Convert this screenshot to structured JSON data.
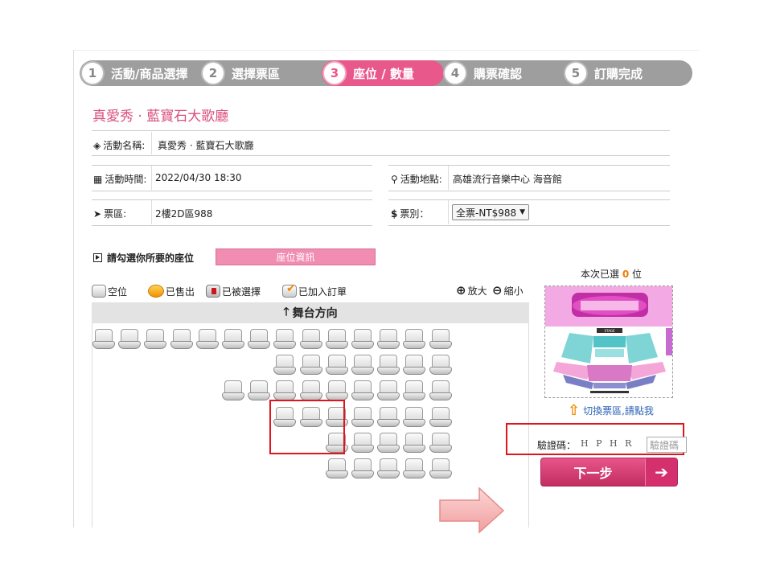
{
  "steps": [
    {
      "num": "1",
      "label": "活動/商品選擇"
    },
    {
      "num": "2",
      "label": "選擇票區"
    },
    {
      "num": "3",
      "label": "座位 / 數量"
    },
    {
      "num": "4",
      "label": "購票確認"
    },
    {
      "num": "5",
      "label": "訂購完成"
    }
  ],
  "event_title": "真愛秀 · 藍寶石大歌廳",
  "info": {
    "name_label": "活動名稱:",
    "name_value": "真愛秀 · 藍寶石大歌廳",
    "time_label": "活動時間:",
    "time_value": "2022/04/30 18:30",
    "place_label": "活動地點:",
    "place_value": "高雄流行音樂中心 海音館",
    "area_label": "票區:",
    "area_value": "2樓2D區988",
    "type_label": "票別：",
    "type_value": "全票-NT$988"
  },
  "choose_label": "請勾選你所要的座位",
  "seat_info_button": "座位資訊",
  "legend": {
    "empty": "空位",
    "sold": "已售出",
    "taken": "已被選擇",
    "ordered": "已加入訂單"
  },
  "zoom": {
    "in": "放大",
    "out": "縮小"
  },
  "stage_label": "舞台方向",
  "seat_rows": [
    {
      "start": 0,
      "count": 14
    },
    {
      "start": 7,
      "count": 7
    },
    {
      "start": 5,
      "count": 9
    },
    {
      "start": 7,
      "count": 7
    },
    {
      "start": 9,
      "count": 5
    },
    {
      "start": 9,
      "count": 5
    }
  ],
  "selected": {
    "prefix": "本次已選",
    "count": "0",
    "suffix": "位"
  },
  "map": {
    "stage_text": "STAGE"
  },
  "switch_link": "切換票區,請點我",
  "captcha": {
    "label": "驗證碼：",
    "image_text": "H P H R",
    "placeholder": "驗證碼"
  },
  "next_button": "下一步",
  "colors": {
    "accent": "#e8588a",
    "step_gray": "#9e9e9e",
    "highlight_red": "#e0141c",
    "link": "#2a62b6"
  }
}
